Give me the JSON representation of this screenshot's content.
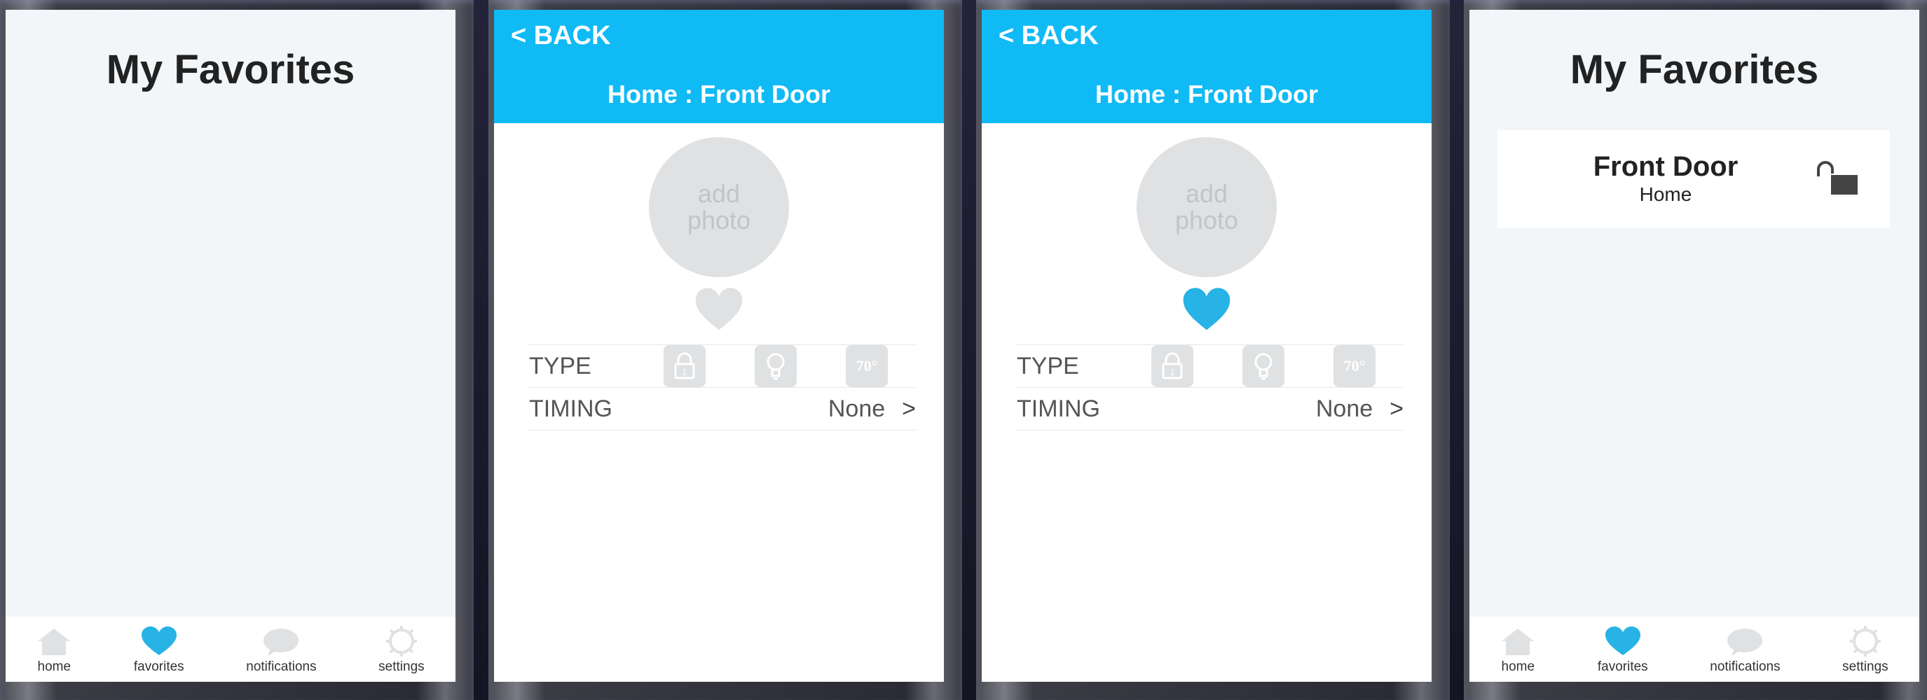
{
  "screens": {
    "s1": {
      "title": "My Favorites",
      "tabs": [
        {
          "label": "home",
          "icon": "home-icon"
        },
        {
          "label": "favorites",
          "icon": "heart-icon",
          "active": true
        },
        {
          "label": "notifications",
          "icon": "speech-bubble-icon"
        },
        {
          "label": "settings",
          "icon": "gear-icon"
        }
      ]
    },
    "s2": {
      "back": "< BACK",
      "breadcrumb": "Home : Front Door",
      "photo_line1": "add",
      "photo_line2": "photo",
      "favorite": false,
      "type_label": "TYPE",
      "temp_label": "70°",
      "timing_label": "TIMING",
      "timing_value": "None",
      "chevron": ">"
    },
    "s3": {
      "back": "< BACK",
      "breadcrumb": "Home : Front Door",
      "photo_line1": "add",
      "photo_line2": "photo",
      "favorite": true,
      "type_label": "TYPE",
      "temp_label": "70°",
      "timing_label": "TIMING",
      "timing_value": "None",
      "chevron": ">"
    },
    "s4": {
      "title": "My Favorites",
      "favorite_item": {
        "name": "Front Door",
        "location": "Home",
        "status_icon": "unlocked-padlock-icon"
      },
      "tabs": [
        {
          "label": "home",
          "icon": "home-icon"
        },
        {
          "label": "favorites",
          "icon": "heart-icon",
          "active": true
        },
        {
          "label": "notifications",
          "icon": "speech-bubble-icon"
        },
        {
          "label": "settings",
          "icon": "gear-icon"
        }
      ]
    }
  },
  "colors": {
    "accent": "#10baf5",
    "heart_active": "#27b3e6",
    "inactive_icon": "#dfe1e3",
    "list_background": "#f2f6f9"
  }
}
